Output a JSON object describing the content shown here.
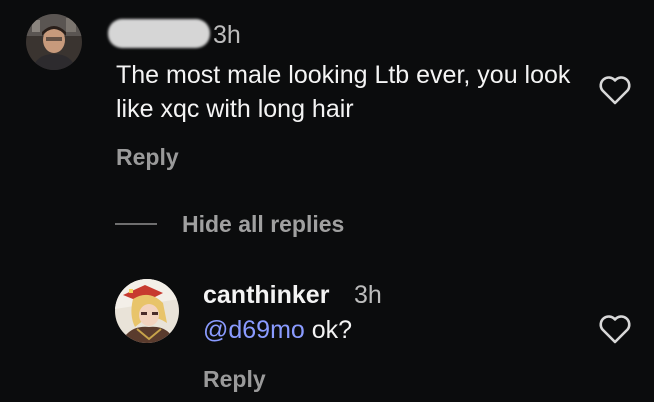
{
  "comment": {
    "avatar_icon": "user-avatar-icon",
    "username": "",
    "time": "3h",
    "text": "The most male looking Ltb ever, you look like xqc with long hair",
    "reply_label": "Reply",
    "like_icon": "heart-outline-icon"
  },
  "thread": {
    "hide_replies_label": "Hide all replies"
  },
  "reply": {
    "avatar_icon": "user-avatar-icon",
    "username": "canthinker",
    "time": "3h",
    "mention": "@d69mo",
    "text": " ok?",
    "reply_label": "Reply",
    "like_icon": "heart-outline-icon"
  },
  "colors": {
    "background": "#0b0c0d",
    "text": "#f4f4f4",
    "muted": "#9a9a9a",
    "mention": "#8a9bff"
  }
}
